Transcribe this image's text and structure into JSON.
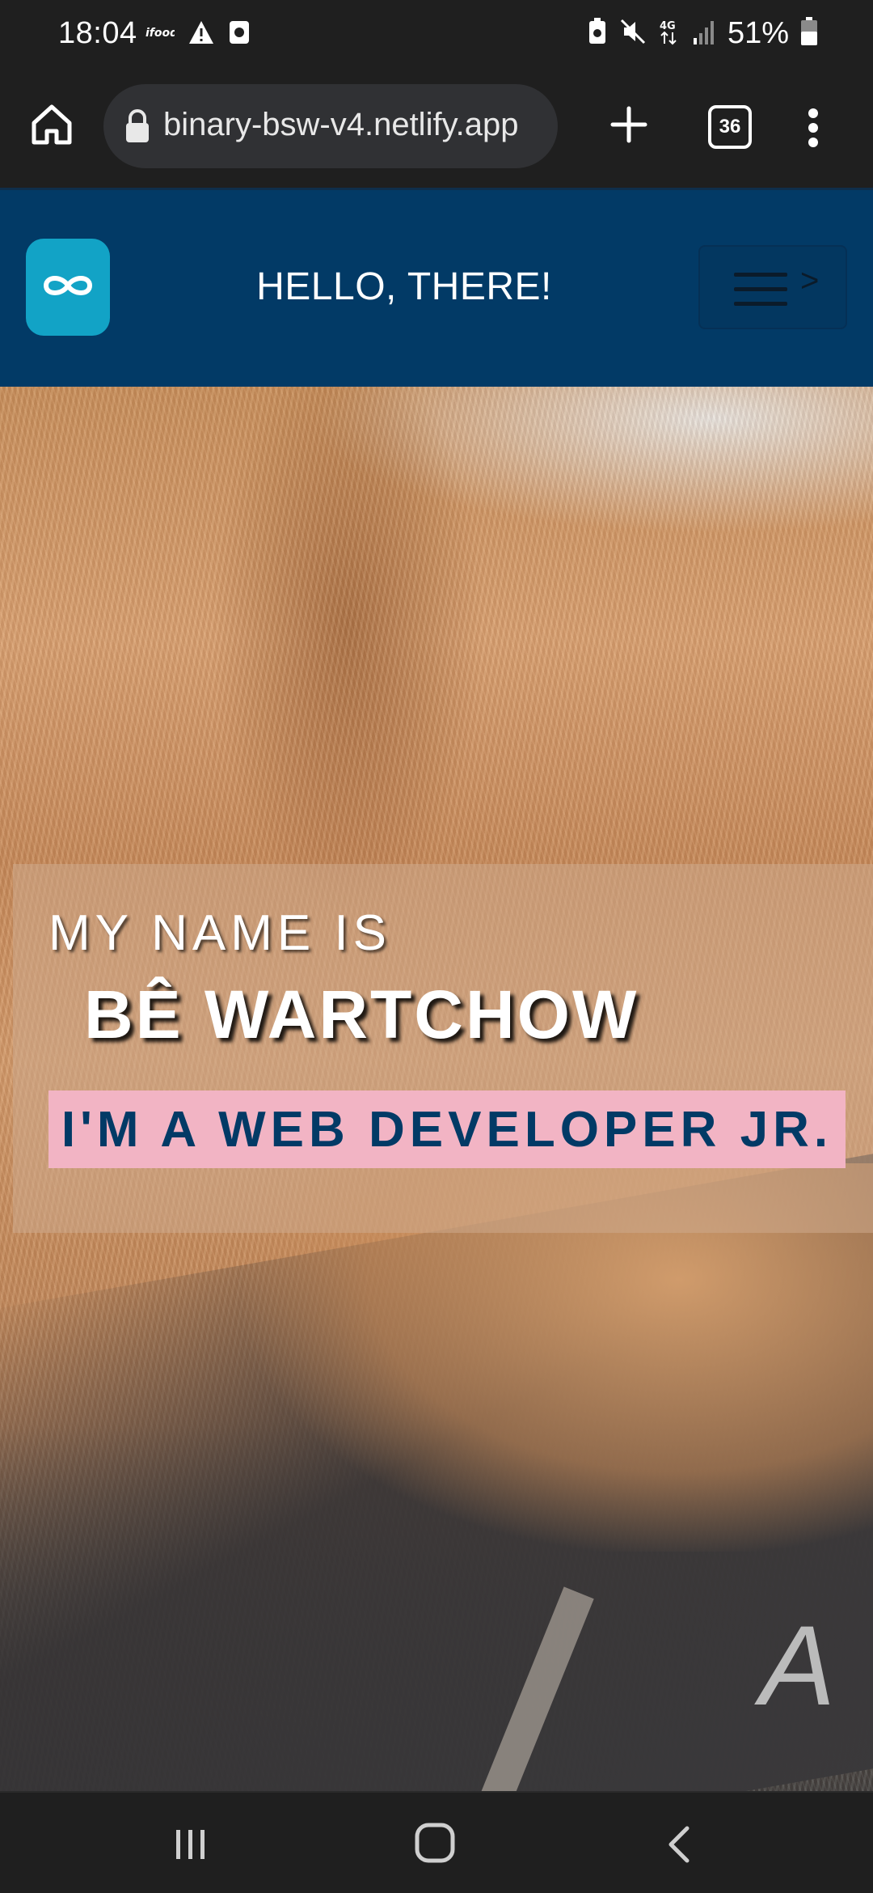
{
  "status_bar": {
    "time": "18:04",
    "battery": "51%",
    "left_icons": [
      "ifood-notification-icon",
      "warning-icon",
      "app-notification-icon"
    ],
    "right_icons": [
      "battery-saver-icon",
      "mute-icon",
      "network-4g-icon",
      "signal-icon",
      "battery-icon"
    ],
    "network_label": "4G"
  },
  "browser": {
    "url": "binary-bsw-v4.netlify.app",
    "tab_count": "36"
  },
  "site_header": {
    "title": "HELLO, THERE!",
    "nav_arrow": ">",
    "logo_icon": "infinity-icon",
    "background": "#023a66",
    "logo_color": "#12a3c6"
  },
  "hero": {
    "line1": "MY NAME IS",
    "name": "BÊ WARTCHOW",
    "role": "I'M A WEB DEVELOPER JR.",
    "key_letter": "A",
    "role_background": "#f2b4c4"
  }
}
